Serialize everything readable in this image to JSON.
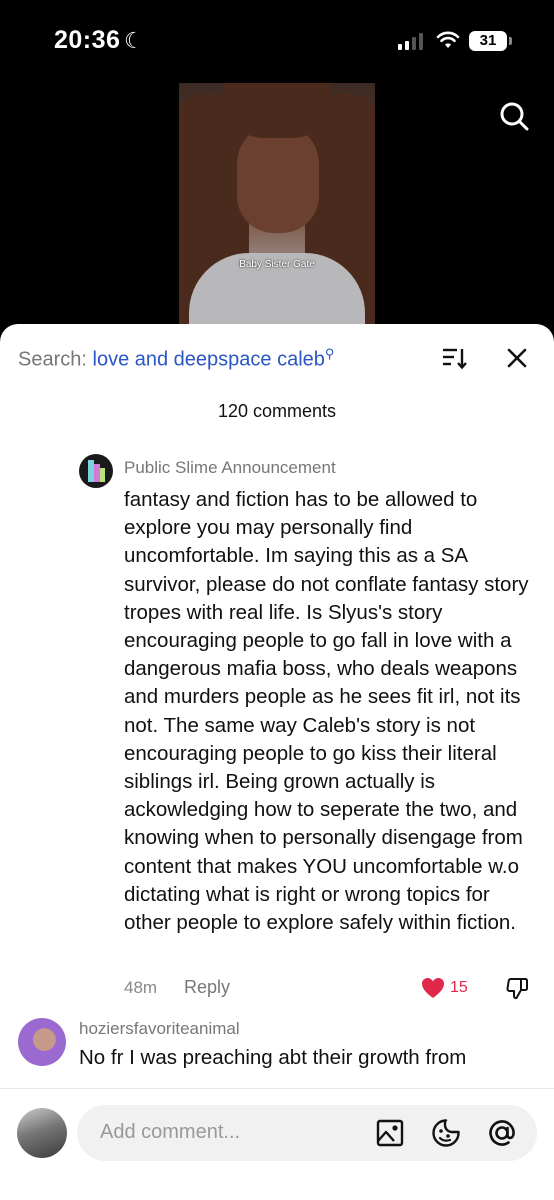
{
  "status_bar": {
    "time": "20:36",
    "battery": "31"
  },
  "video": {
    "caption": "Baby Sister Gate"
  },
  "header": {
    "search_label": "Search:",
    "search_term": "love and deepspace caleb",
    "comments_count": "120 comments"
  },
  "comments": [
    {
      "username": "Public Slime Announcement",
      "text": "fantasy and fiction has to be allowed to explore you may personally find uncomfortable. Im saying this as a SA survivor, please do not conflate fantasy story tropes with real life. Is Slyus's story encouraging people to go fall in love with a dangerous mafia boss, who deals weapons and murders people as he sees fit irl, not its not. The same way Caleb's story is not encouraging people to go kiss their literal siblings irl. Being grown actually is ackowledging how to seperate the two, and knowing when to personally disengage from content that makes YOU uncomfortable w.o dictating what is right or wrong topics for other people to explore safely within fiction.",
      "time": "48m",
      "reply_label": "Reply",
      "likes": "15"
    },
    {
      "username": "hoziersfavoriteanimal",
      "text": "No fr I was preaching abt their growth from"
    }
  ],
  "composer": {
    "placeholder": "Add comment..."
  },
  "colors": {
    "accent_link": "#2a56c6",
    "like_red": "#e0284a"
  }
}
